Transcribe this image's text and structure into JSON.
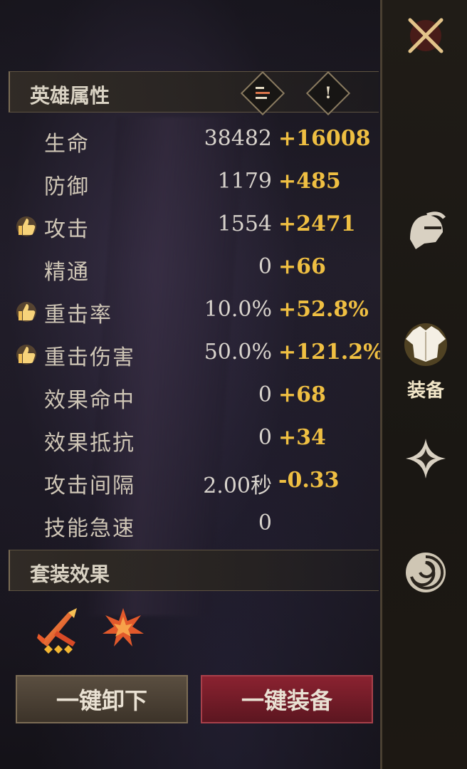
{
  "hero_attributes": {
    "title": "英雄属性",
    "sort_icon": "sort-lines-icon",
    "info_icon": "exclamation-icon",
    "stats": [
      {
        "label": "生命",
        "base": "38482",
        "bonus": "+16008",
        "recommended": false
      },
      {
        "label": "防御",
        "base": "1179",
        "bonus": "+485",
        "recommended": false
      },
      {
        "label": "攻击",
        "base": "1554",
        "bonus": "+2471",
        "recommended": true
      },
      {
        "label": "精通",
        "base": "0",
        "bonus": "+66",
        "recommended": false
      },
      {
        "label": "重击率",
        "base": "10.0%",
        "bonus": "+52.8%",
        "recommended": true
      },
      {
        "label": "重击伤害",
        "base": "50.0%",
        "bonus": "+121.2%",
        "recommended": true
      },
      {
        "label": "效果命中",
        "base": "0",
        "bonus": "+68",
        "recommended": false
      },
      {
        "label": "效果抵抗",
        "base": "0",
        "bonus": "+34",
        "recommended": false
      },
      {
        "label": "攻击间隔",
        "base": "2.00秒",
        "bonus": "-0.33",
        "recommended": false
      },
      {
        "label": "技能急速",
        "base": "0",
        "bonus": "",
        "recommended": false
      }
    ]
  },
  "set_effects": {
    "title": "套装效果",
    "icons": [
      "crossed-swords-set-icon",
      "spiked-burst-set-icon"
    ],
    "set_pieces_shown": 3
  },
  "buttons": {
    "unequip_all": "一键卸下",
    "equip_all": "一键装备"
  },
  "sidebar": {
    "close_icon": "close-icon",
    "items": [
      {
        "icon": "helmet-icon",
        "label": ""
      },
      {
        "icon": "armor-icon",
        "label": "装备",
        "active": true
      },
      {
        "icon": "star-shard-icon",
        "label": ""
      },
      {
        "icon": "swirl-icon",
        "label": ""
      }
    ]
  },
  "colors": {
    "bonus": "#efbf42",
    "label": "#cfc6b6",
    "equip_button": "#8a2230",
    "unequip_button": "#5a4e40"
  }
}
